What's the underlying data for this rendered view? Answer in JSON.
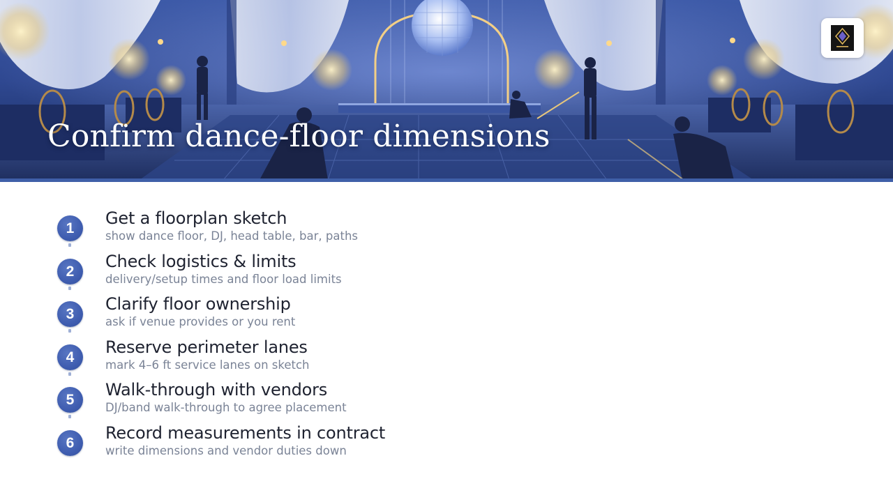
{
  "banner": {
    "title": "Confirm dance-floor dimensions",
    "logo_icon": "brand-logo-icon"
  },
  "colors": {
    "accent": "#3f5db0",
    "banner_rule": "#3f5fa8",
    "title_text": "#1e2230",
    "desc_text": "#7a8396"
  },
  "steps": [
    {
      "number": "1",
      "title": "Get a floorplan sketch",
      "description": "show dance floor, DJ, head table, bar, paths"
    },
    {
      "number": "2",
      "title": "Check logistics & limits",
      "description": "delivery/setup times and floor load limits"
    },
    {
      "number": "3",
      "title": "Clarify floor ownership",
      "description": "ask if venue provides or you rent"
    },
    {
      "number": "4",
      "title": "Reserve perimeter lanes",
      "description": "mark 4–6 ft service lanes on sketch"
    },
    {
      "number": "5",
      "title": "Walk-through with vendors",
      "description": "DJ/band walk-through to agree placement"
    },
    {
      "number": "6",
      "title": "Record measurements in contract",
      "description": "write dimensions and vendor duties down"
    }
  ]
}
